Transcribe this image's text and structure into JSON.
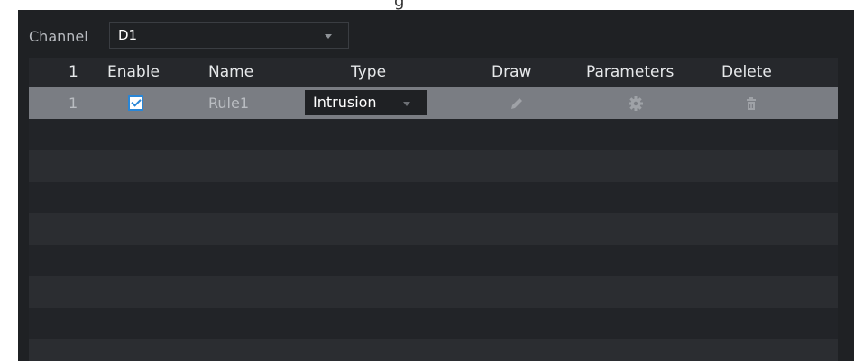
{
  "header_fragment": "g",
  "channel": {
    "label": "Channel",
    "value": "D1"
  },
  "table": {
    "columns": [
      "1",
      "Enable",
      "Name",
      "Type",
      "Draw",
      "Parameters",
      "Delete"
    ],
    "rows": [
      {
        "index": "1",
        "enabled": true,
        "name": "Rule1",
        "type": "Intrusion",
        "draw_icon": "pencil-icon",
        "parameters_icon": "gear-icon",
        "delete_icon": "trash-icon"
      }
    ]
  },
  "colors": {
    "panel_bg": "#1f2124",
    "selected_row": "#7a7d83",
    "checkbox_accent": "#2a86d6"
  }
}
